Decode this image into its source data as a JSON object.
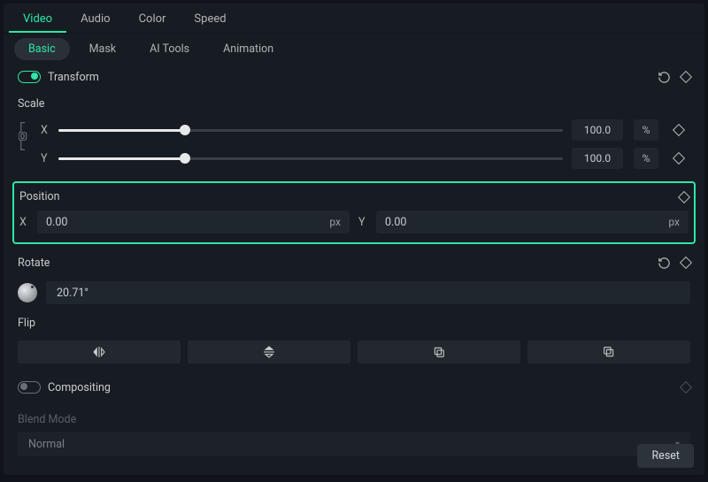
{
  "tabs_top": {
    "video": "Video",
    "audio": "Audio",
    "color": "Color",
    "speed": "Speed"
  },
  "tabs_sub": {
    "basic": "Basic",
    "mask": "Mask",
    "ai_tools": "AI Tools",
    "animation": "Animation"
  },
  "transform": {
    "title": "Transform"
  },
  "scale": {
    "title": "Scale",
    "x_label": "X",
    "x_value": "100.0",
    "x_unit": "%",
    "y_label": "Y",
    "y_value": "100.0",
    "y_unit": "%"
  },
  "position": {
    "title": "Position",
    "x_label": "X",
    "x_value": "0.00",
    "x_unit": "px",
    "y_label": "Y",
    "y_value": "0.00",
    "y_unit": "px"
  },
  "rotate": {
    "title": "Rotate",
    "value": "20.71°"
  },
  "flip": {
    "title": "Flip"
  },
  "compositing": {
    "title": "Compositing"
  },
  "blend": {
    "label": "Blend Mode",
    "value": "Normal"
  },
  "footer": {
    "reset": "Reset"
  }
}
